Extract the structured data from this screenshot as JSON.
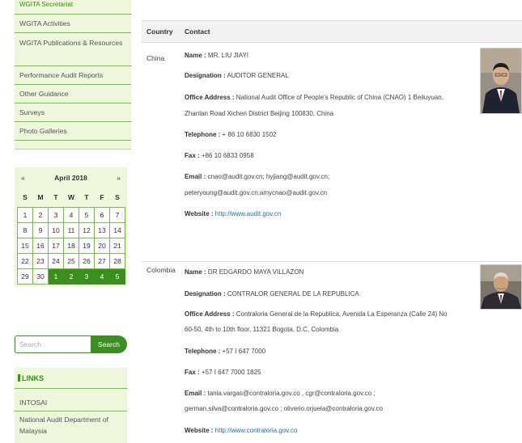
{
  "sidebar": {
    "nav_items": [
      "WGITA Secretariat",
      "WGITA Activities",
      "WGITA Publications & Resources",
      "Performance Audit Reports",
      "Other Guidance",
      "Surveys",
      "Photo Galleries"
    ],
    "calendar": {
      "prev": "«",
      "next": "»",
      "title": "April 2018",
      "weekdays": [
        "S",
        "M",
        "T",
        "W",
        "T",
        "F",
        "S"
      ],
      "weeks": [
        [
          "1",
          "2",
          "3",
          "4",
          "5",
          "6",
          "7"
        ],
        [
          "8",
          "9",
          "10",
          "11",
          "12",
          "13",
          "14"
        ],
        [
          "15",
          "16",
          "17",
          "18",
          "19",
          "20",
          "21"
        ],
        [
          "22",
          "23",
          "24",
          "25",
          "26",
          "27",
          "28"
        ],
        [
          "29",
          "30",
          "1",
          "2",
          "3",
          "4",
          "5"
        ]
      ]
    },
    "search": {
      "placeholder": "Search",
      "button_label": "Search"
    },
    "links": {
      "title": "LINKS",
      "items": [
        "INTOSAI",
        "National Audit Department of Malaysia"
      ]
    }
  },
  "table": {
    "headers": {
      "country": "Country",
      "contact": "Contact"
    },
    "rows": [
      {
        "country": "China",
        "name_label": "Name :",
        "name": "MR. LIU JIAYI",
        "designation_label": "Designation :",
        "designation": "AUDITOR GENERAL",
        "address_label": "Office Address :",
        "address_line1": "National Audit Office of People's Republic of China (CNAO) 1 Beiluyuan,",
        "address_line2": "Zhanlan Road Xichen District Beijing 100830, China",
        "telephone_label": "Telephone :",
        "telephone": "+ 86 10 6830 1502",
        "fax_label": "Fax :",
        "fax": "+86 10 6833 0958",
        "email_label": "Email :",
        "email_line1": "cnao@audit.gov.cn; hyjiang@audit.gov.cn;",
        "email_line2": "peteryoung@audit.gov.cn;amycnao@audit.gov.cn",
        "website_label": "Website :",
        "website": "http://www.audit.gov.cn"
      },
      {
        "country": "Colombia",
        "name_label": "Name :",
        "name": "DR EDGARDO MAYA VILLAZON",
        "designation_label": "Designation :",
        "designation": "CONTRALOR GENERAL DE LA REPUBLICA",
        "address_label": "Office Address :",
        "address_line1": "Contraloria General de la Republica, Avenida La Esperanza (Calle 24) No",
        "address_line2": "60-50, 4th to 10th floor, 11321 Bogota, D.C, Colombia",
        "telephone_label": "Telephone :",
        "telephone": "+57 I 647 7000",
        "fax_label": "Fax :",
        "fax": "+57 I 647 7000 1825",
        "email_label": "Email :",
        "email_line1": "tania.vargas@contraloria.gov.co , cgr@contraloria.gov.co ;",
        "email_line2": "german.silva@contraloria.gov.co ; oliverio.orjuela@contraloria.gov.co",
        "website_label": "Website :",
        "website": "http://www.contraloria.gov.co"
      }
    ]
  }
}
